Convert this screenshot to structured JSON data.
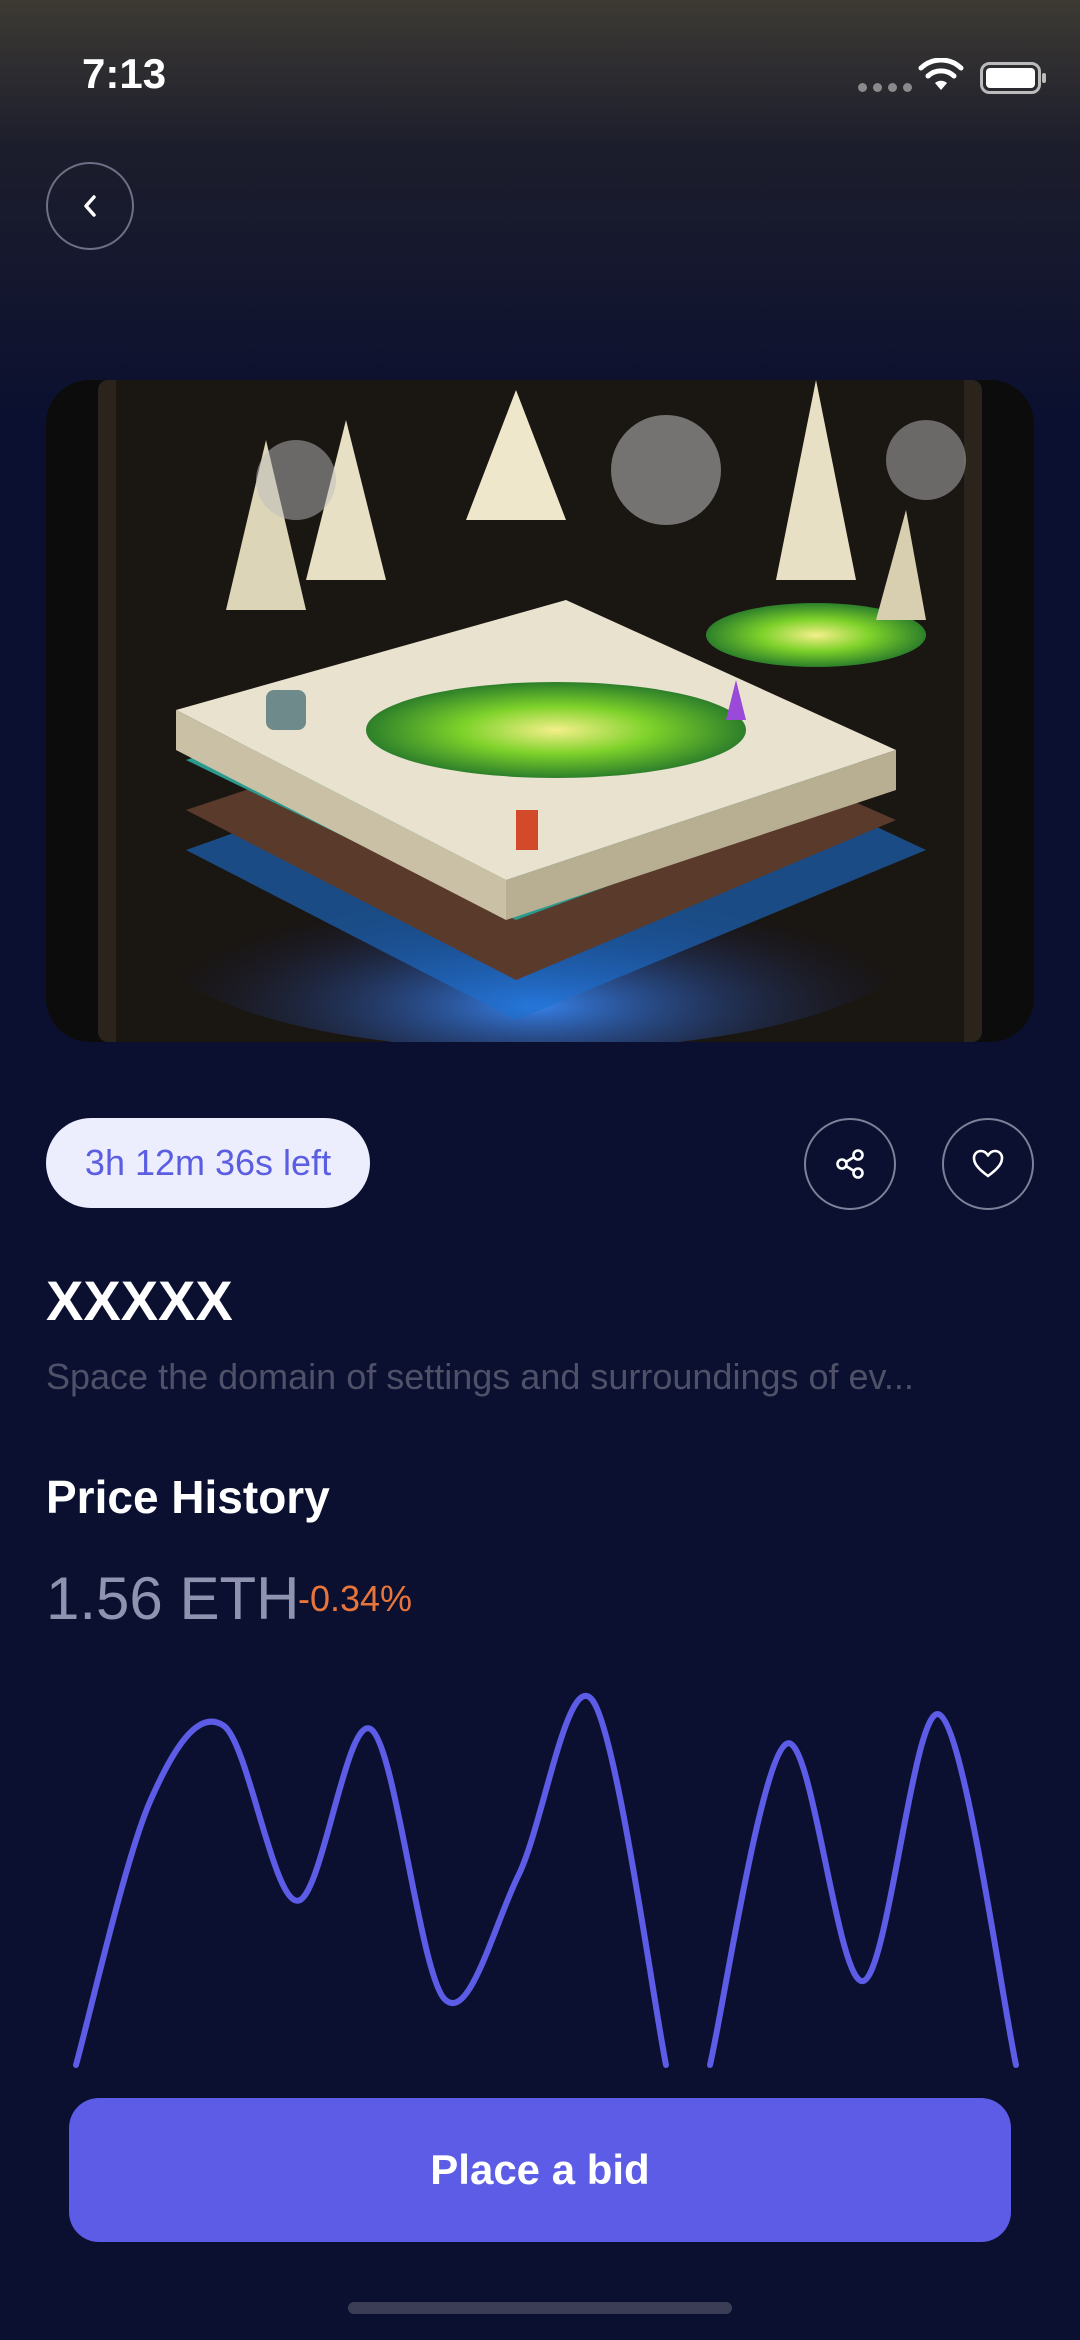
{
  "status_bar": {
    "time": "7:13",
    "icons": [
      "signal-icon",
      "wifi-icon",
      "battery-icon"
    ]
  },
  "header": {
    "back_icon": "chevron-left-icon"
  },
  "artwork": {
    "description_icon": "isometric-island-artwork"
  },
  "auction": {
    "time_left": "3h 12m 36s left"
  },
  "actions": {
    "share_icon": "share-icon",
    "like_icon": "heart-icon"
  },
  "item": {
    "title": "XXXXX",
    "description": "Space the domain of settings and surroundings of ev..."
  },
  "price_history": {
    "heading": "Price History",
    "price": "1.56 ETH",
    "change": "-0.34%",
    "change_color": "#e8753a",
    "line_color": "#5c5ce6"
  },
  "cta": {
    "label": "Place a bid",
    "color": "#5c5ce6"
  },
  "chart_data": {
    "type": "line",
    "title": "",
    "xlabel": "",
    "ylabel": "",
    "grid": false,
    "series": [
      {
        "values": [
          0,
          72,
          93,
          45,
          92,
          18,
          52,
          100,
          0
        ]
      },
      {
        "values": [
          0,
          88,
          23,
          96,
          0
        ]
      }
    ]
  }
}
